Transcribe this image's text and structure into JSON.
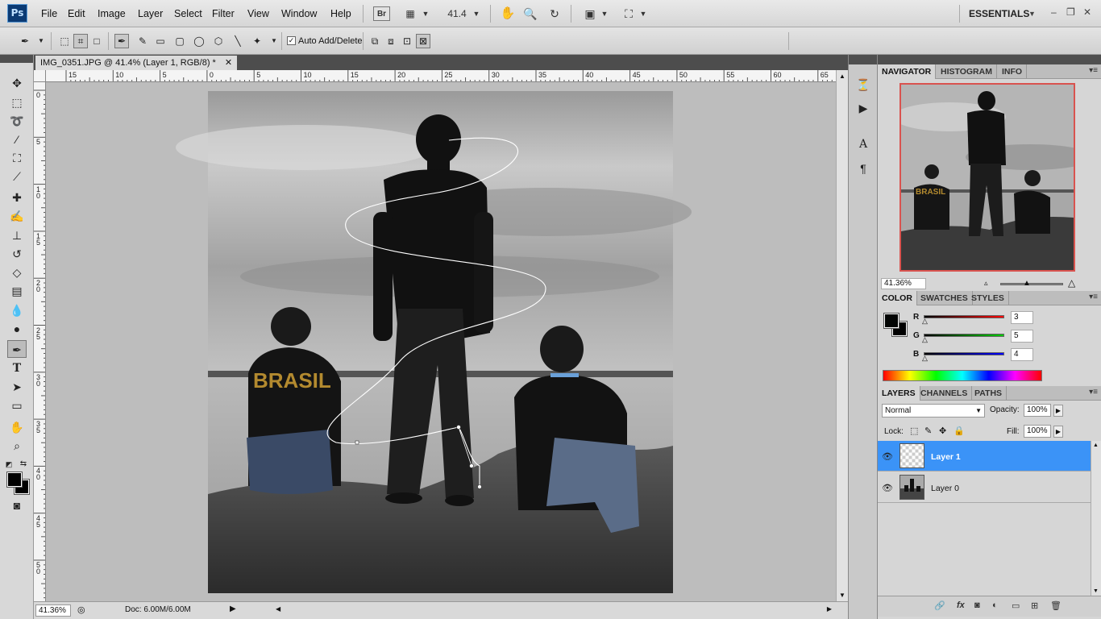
{
  "app": {
    "logo": "Ps",
    "menu": [
      "File",
      "Edit",
      "Image",
      "Layer",
      "Select",
      "Filter",
      "View",
      "Window",
      "Help"
    ],
    "bridge_label": "Br",
    "zoom_level": "41.4",
    "workspace": "ESSENTIALS"
  },
  "options_bar": {
    "auto_add_delete_label": "Auto Add/Delete",
    "auto_add_delete_checked": true
  },
  "document": {
    "tab_title": "IMG_0351.JPG @ 41.4% (Layer 1, RGB/8) *",
    "ruler_h_labels": [
      "15",
      "10",
      "5",
      "0",
      "5",
      "10",
      "15",
      "20",
      "25",
      "30",
      "35",
      "40",
      "45",
      "50",
      "55",
      "60",
      "65"
    ],
    "ruler_v_labels": [
      "0",
      "5",
      "1\n0",
      "1\n5",
      "2\n0",
      "2\n5",
      "3\n0",
      "3\n5",
      "4\n0",
      "4\n5",
      "5\n0"
    ],
    "photo_text": "BRASIL"
  },
  "status": {
    "zoom": "41.36%",
    "doc_info": "Doc: 6.00M/6.00M"
  },
  "navigator": {
    "tabs": [
      "NAVIGATOR",
      "HISTOGRAM",
      "INFO"
    ],
    "zoom": "41.36%",
    "photo_text": "BRASIL"
  },
  "color_panel": {
    "tabs": [
      "COLOR",
      "SWATCHES",
      "STYLES"
    ],
    "channels": [
      {
        "label": "R",
        "value": "3"
      },
      {
        "label": "G",
        "value": "5"
      },
      {
        "label": "B",
        "value": "4"
      }
    ],
    "fg_color": "#030504",
    "bg_color": "#000000"
  },
  "layers_panel": {
    "tabs": [
      "LAYERS",
      "CHANNELS",
      "PATHS"
    ],
    "blend_mode": "Normal",
    "opacity_label": "Opacity:",
    "opacity": "100%",
    "lock_label": "Lock:",
    "fill_label": "Fill:",
    "fill": "100%",
    "layers": [
      {
        "name": "Layer 1",
        "selected": true,
        "visible": true
      },
      {
        "name": "Layer 0",
        "selected": false,
        "visible": true
      }
    ]
  }
}
